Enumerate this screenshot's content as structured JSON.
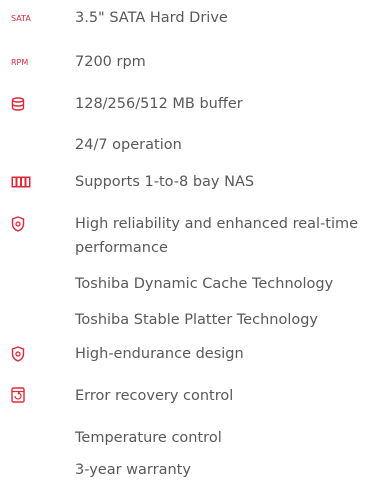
{
  "accent": "#e0283a",
  "text_color": "#595959",
  "features": [
    {
      "icon": "sata-icon",
      "icon_text": "SATA",
      "label": "3.5\" SATA Hard Drive"
    },
    {
      "icon": "rpm-icon",
      "icon_text": "RPM",
      "label": "7200 rpm"
    },
    {
      "icon": "database-icon",
      "label": "128/256/512 MB buffer"
    },
    {
      "icon": "",
      "label": "24/7 operation"
    },
    {
      "icon": "nas-bays-icon",
      "label": "Supports 1-to-8 bay NAS"
    },
    {
      "icon": "shield-icon",
      "label": "High reliability and enhanced real-time performance"
    },
    {
      "icon": "",
      "label": "Toshiba Dynamic Cache Technology"
    },
    {
      "icon": "",
      "label": "Toshiba Stable Platter Technology"
    },
    {
      "icon": "shield-icon",
      "label": "High-endurance design"
    },
    {
      "icon": "error-recovery-icon",
      "label": "Error recovery control"
    },
    {
      "icon": "",
      "label": "Temperature control"
    },
    {
      "icon": "",
      "label": "3-year warranty"
    }
  ]
}
